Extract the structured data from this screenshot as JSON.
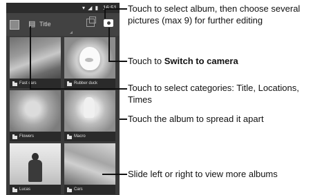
{
  "statusbar": {
    "icons": "▾ ◢ ▮",
    "time": "16:51"
  },
  "actionbar": {
    "title": "Title",
    "folder_glyph": "▤"
  },
  "albums": [
    {
      "label": "Fast cars",
      "count": ""
    },
    {
      "label": "Rubber duck",
      "count": ""
    },
    {
      "label": "Flowers",
      "count": ""
    },
    {
      "label": "Macro",
      "count": ""
    },
    {
      "label": "Lucas",
      "count": ""
    },
    {
      "label": "Cars",
      "count": ""
    }
  ],
  "callouts": {
    "c1_line1": "Touch to select album, then choose several",
    "c1_line2": "pictures (max 9) for further editing",
    "c2_prefix": "Touch to ",
    "c2_bold": "Switch to camera",
    "c3_line1": "Touch to select categories: Title, Locations,",
    "c3_line2": "Times",
    "c4": "Touch the album to spread it apart",
    "c5": "Slide left or right to view more albums"
  }
}
